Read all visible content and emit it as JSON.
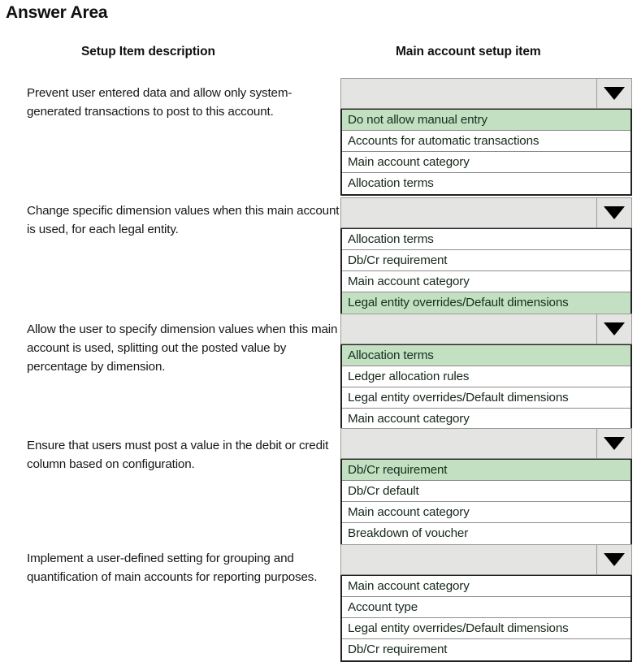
{
  "page_title": "Answer Area",
  "columns": {
    "left_header": "Setup Item description",
    "right_header": "Main account setup item"
  },
  "colors": {
    "highlight_green": "#c3e0c3",
    "combo_gray": "#e4e4e2",
    "list_border": "#222222",
    "page_background": "#ffffff"
  },
  "dropdown_icon": "chevron-down-icon",
  "rows": [
    {
      "description": "Prevent user entered data and allow only system-generated transactions to post to this account.",
      "selected_value": "",
      "options": [
        {
          "label": "Do not allow manual entry",
          "selected": true
        },
        {
          "label": "Accounts for automatic transactions",
          "selected": false
        },
        {
          "label": "Main account category",
          "selected": false
        },
        {
          "label": "Allocation terms",
          "selected": false
        }
      ]
    },
    {
      "description": "Change specific dimension values when this main account is used, for each legal entity.",
      "selected_value": "",
      "options": [
        {
          "label": "Allocation terms",
          "selected": false
        },
        {
          "label": "Db/Cr requirement",
          "selected": false
        },
        {
          "label": "Main account category",
          "selected": false
        },
        {
          "label": "Legal entity overrides/Default dimensions",
          "selected": true
        }
      ]
    },
    {
      "description": "Allow the user to specify dimension values when this main account is used, splitting out the posted value by percentage by dimension.",
      "selected_value": "",
      "options": [
        {
          "label": "Allocation terms",
          "selected": true
        },
        {
          "label": "Ledger allocation rules",
          "selected": false
        },
        {
          "label": "Legal entity overrides/Default dimensions",
          "selected": false
        },
        {
          "label": "Main account category",
          "selected": false
        }
      ]
    },
    {
      "description": "Ensure that users must post a value in the debit or credit column based on configuration.",
      "selected_value": "",
      "options": [
        {
          "label": "Db/Cr requirement",
          "selected": true
        },
        {
          "label": "Db/Cr default",
          "selected": false
        },
        {
          "label": "Main account category",
          "selected": false
        },
        {
          "label": "Breakdown of voucher",
          "selected": false
        }
      ]
    },
    {
      "description": "Implement a user-defined setting for grouping and quantification of main accounts for reporting purposes.",
      "selected_value": "",
      "options": [
        {
          "label": "Main account category",
          "selected": false
        },
        {
          "label": "Account type",
          "selected": false
        },
        {
          "label": "Legal entity overrides/Default dimensions",
          "selected": false
        },
        {
          "label": "Db/Cr requirement",
          "selected": false
        }
      ]
    }
  ]
}
